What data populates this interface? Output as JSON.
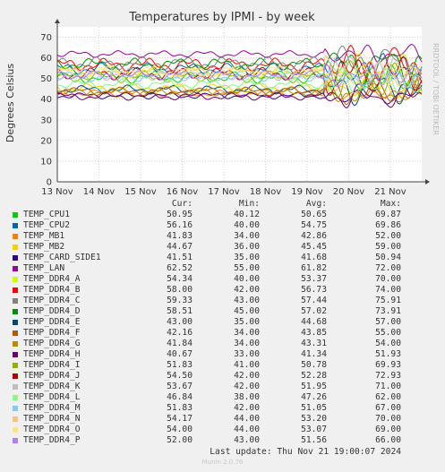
{
  "chart_data": {
    "type": "line",
    "title": "Temperatures by IPMI - by week",
    "ylabel": "Degrees Celsius",
    "side_label": "RRDTOOL / TOBI OETIKER",
    "ylim": [
      0,
      75
    ],
    "yticks": [
      0,
      10,
      20,
      30,
      40,
      50,
      60,
      70
    ],
    "x_categories": [
      "13 Nov",
      "14 Nov",
      "15 Nov",
      "16 Nov",
      "17 Nov",
      "18 Nov",
      "19 Nov",
      "20 Nov",
      "21 Nov"
    ],
    "grid": true,
    "legend_columns": [
      "Cur:",
      "Min:",
      "Avg:",
      "Max:"
    ],
    "series": [
      {
        "name": "TEMP_CPU1",
        "color": "#00cc00",
        "cur": "50.95",
        "min": "40.12",
        "avg": "50.65",
        "max": "69.87",
        "level": 50.65
      },
      {
        "name": "TEMP_CPU2",
        "color": "#0066b3",
        "cur": "56.16",
        "min": "40.00",
        "avg": "54.75",
        "max": "69.86",
        "level": 54.75
      },
      {
        "name": "TEMP_MB1",
        "color": "#ff8000",
        "cur": "41.83",
        "min": "34.00",
        "avg": "42.86",
        "max": "52.00",
        "level": 42.86
      },
      {
        "name": "TEMP_MB2",
        "color": "#ffcc00",
        "cur": "44.67",
        "min": "36.00",
        "avg": "45.45",
        "max": "59.00",
        "level": 45.45
      },
      {
        "name": "TEMP_CARD_SIDE1",
        "color": "#330099",
        "cur": "41.51",
        "min": "35.00",
        "avg": "41.68",
        "max": "50.94",
        "level": 41.68
      },
      {
        "name": "TEMP_LAN",
        "color": "#990099",
        "cur": "62.52",
        "min": "55.00",
        "avg": "61.82",
        "max": "72.00",
        "level": 61.82
      },
      {
        "name": "TEMP_DDR4_A",
        "color": "#ccff00",
        "cur": "54.34",
        "min": "40.00",
        "avg": "53.37",
        "max": "70.00",
        "level": 53.37
      },
      {
        "name": "TEMP_DDR4_B",
        "color": "#ff0000",
        "cur": "58.00",
        "min": "42.00",
        "avg": "56.73",
        "max": "74.00",
        "level": 56.73
      },
      {
        "name": "TEMP_DDR4_C",
        "color": "#808080",
        "cur": "59.33",
        "min": "43.00",
        "avg": "57.44",
        "max": "75.91",
        "level": 57.44
      },
      {
        "name": "TEMP_DDR4_D",
        "color": "#008f00",
        "cur": "58.51",
        "min": "45.00",
        "avg": "57.02",
        "max": "73.91",
        "level": 57.02
      },
      {
        "name": "TEMP_DDR4_E",
        "color": "#00487d",
        "cur": "43.00",
        "min": "35.00",
        "avg": "44.68",
        "max": "57.00",
        "level": 44.68
      },
      {
        "name": "TEMP_DDR4_F",
        "color": "#b35a00",
        "cur": "42.16",
        "min": "34.00",
        "avg": "43.85",
        "max": "55.00",
        "level": 43.85
      },
      {
        "name": "TEMP_DDR4_G",
        "color": "#b38f00",
        "cur": "41.84",
        "min": "34.00",
        "avg": "43.31",
        "max": "54.00",
        "level": 43.31
      },
      {
        "name": "TEMP_DDR4_H",
        "color": "#6b006b",
        "cur": "40.67",
        "min": "33.00",
        "avg": "41.34",
        "max": "51.93",
        "level": 41.34
      },
      {
        "name": "TEMP_DDR4_I",
        "color": "#8fb300",
        "cur": "51.83",
        "min": "41.00",
        "avg": "50.78",
        "max": "69.93",
        "level": 50.78
      },
      {
        "name": "TEMP_DDR4_J",
        "color": "#b30000",
        "cur": "54.50",
        "min": "42.00",
        "avg": "52.28",
        "max": "72.93",
        "level": 52.28
      },
      {
        "name": "TEMP_DDR4_K",
        "color": "#bebebe",
        "cur": "53.67",
        "min": "42.00",
        "avg": "51.95",
        "max": "71.00",
        "level": 51.95
      },
      {
        "name": "TEMP_DDR4_L",
        "color": "#80ff80",
        "cur": "46.84",
        "min": "38.00",
        "avg": "47.26",
        "max": "62.00",
        "level": 47.26
      },
      {
        "name": "TEMP_DDR4_M",
        "color": "#80c9ff",
        "cur": "51.83",
        "min": "42.00",
        "avg": "51.05",
        "max": "67.00",
        "level": 51.05
      },
      {
        "name": "TEMP_DDR4_N",
        "color": "#ffc080",
        "cur": "54.17",
        "min": "44.00",
        "avg": "53.20",
        "max": "70.00",
        "level": 53.2
      },
      {
        "name": "TEMP_DDR4_O",
        "color": "#ffe680",
        "cur": "54.00",
        "min": "44.00",
        "avg": "53.07",
        "max": "69.00",
        "level": 53.07
      },
      {
        "name": "TEMP_DDR4_P",
        "color": "#aa80ff",
        "cur": "52.00",
        "min": "43.00",
        "avg": "51.56",
        "max": "66.00",
        "level": 51.56
      }
    ]
  },
  "last_update": "Last update: Thu Nov 21 19:00:07 2024",
  "footer": "Munin 2.0.76"
}
